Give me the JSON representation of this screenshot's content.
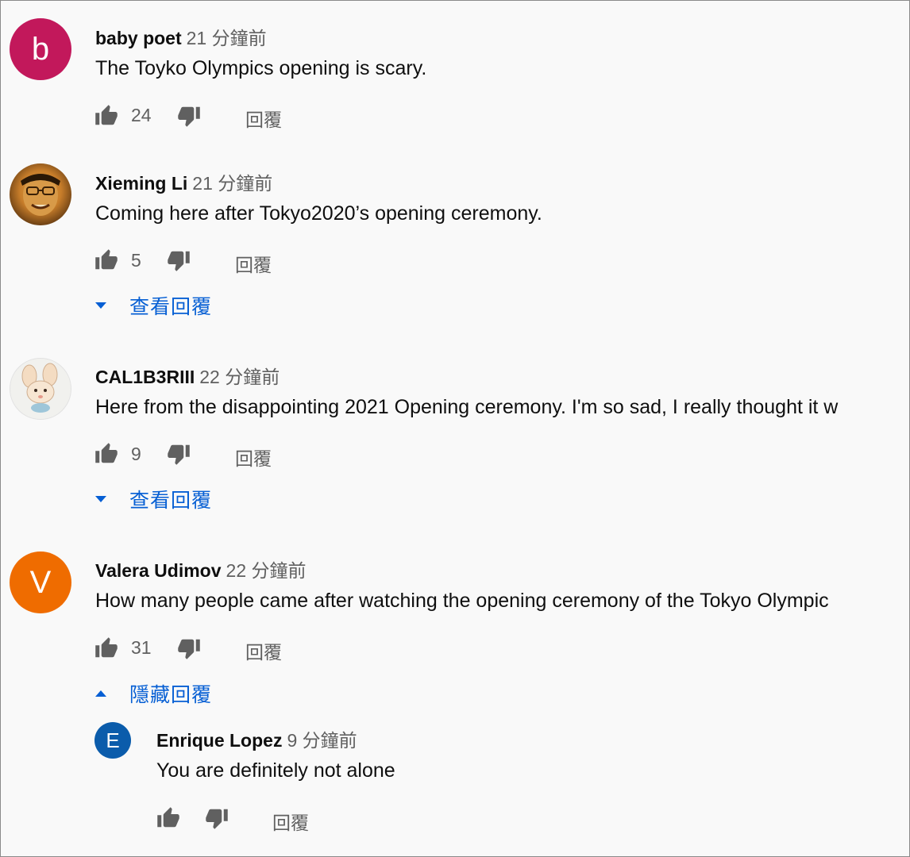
{
  "comments": [
    {
      "author": "baby poet",
      "time": "21 分鐘前",
      "text": "The Toyko Olympics opening is scary.",
      "avatar_letter": "b",
      "avatar_color": "#c2185b",
      "likes": "24",
      "reply_label": "回覆"
    },
    {
      "author": "Xieming Li",
      "time": "21 分鐘前",
      "text": "Coming here after Tokyo2020’s opening ceremony.",
      "likes": "5",
      "reply_label": "回覆",
      "view_replies": "查看回覆"
    },
    {
      "author": "CAL1B3RIII",
      "time": "22 分鐘前",
      "text": "Here from the disappointing 2021 Opening ceremony. I'm so sad, I really thought it w",
      "likes": "9",
      "reply_label": "回覆",
      "view_replies": "查看回覆"
    },
    {
      "author": "Valera Udimov",
      "time": "22 分鐘前",
      "text": "How many people came after watching the opening ceremony of the Tokyo Olympic",
      "avatar_letter": "V",
      "avatar_color": "#ef6c00",
      "likes": "31",
      "reply_label": "回覆",
      "hide_replies": "隱藏回覆"
    }
  ],
  "reply": {
    "author": "Enrique Lopez",
    "time": "9 分鐘前",
    "text": "You are definitely not alone",
    "avatar_letter": "E",
    "avatar_color": "#0b5cab",
    "reply_label": "回覆"
  },
  "colors": {
    "link": "#065fd4",
    "secondary": "#606060",
    "background": "#f9f9f9"
  }
}
